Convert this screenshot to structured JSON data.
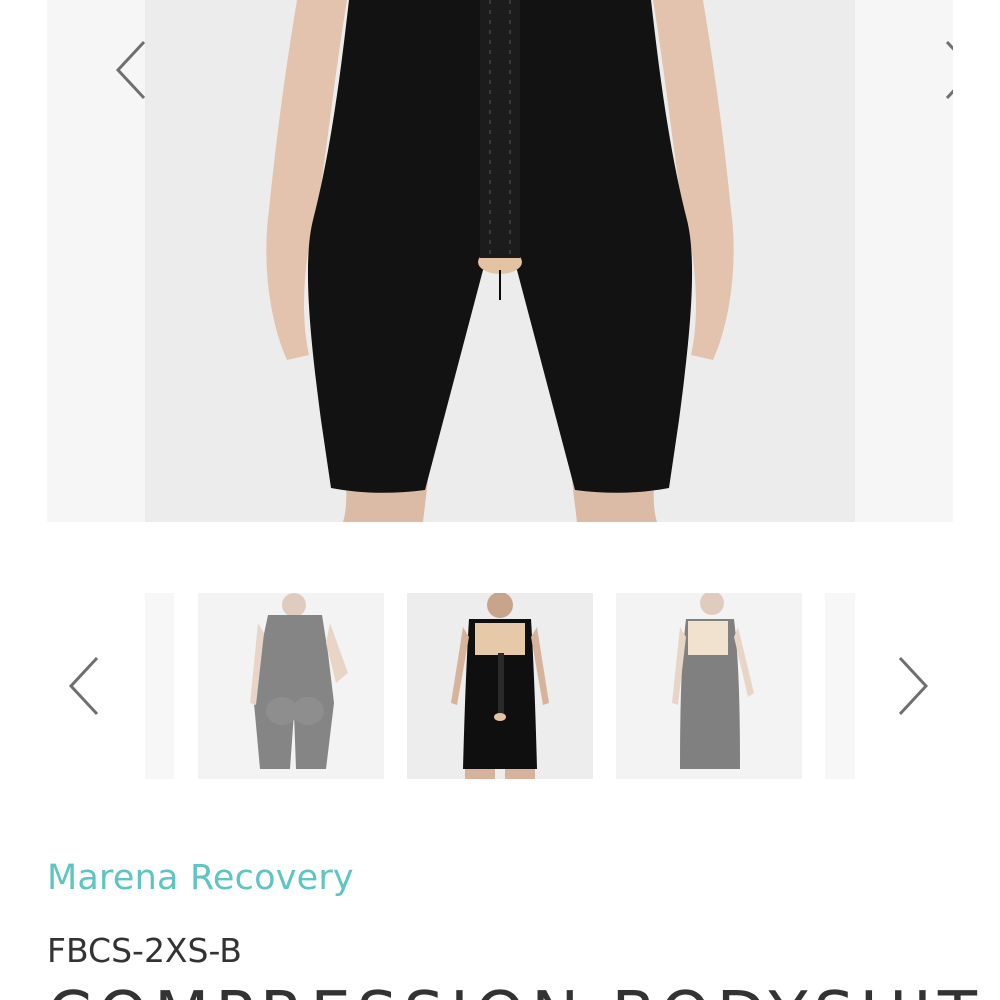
{
  "gallery": {
    "main_image_alt": "Black full-body compression bodysuit with front hook closure",
    "prev_label": "Previous image",
    "next_label": "Next image",
    "thumbnails": [
      {
        "name": "side-edge",
        "state": "dim"
      },
      {
        "name": "back-view",
        "state": "dim"
      },
      {
        "name": "front-view",
        "state": "selected"
      },
      {
        "name": "angle-view",
        "state": "dim"
      },
      {
        "name": "next-edge",
        "state": "dim"
      }
    ],
    "icons": {
      "prev": "chevron-left-icon",
      "next": "chevron-right-icon"
    },
    "colors": {
      "arrow": "#6f6f6f",
      "garment": "#111111",
      "bra_nude": "#e6c9a8"
    }
  },
  "product": {
    "brand": "Marena Recovery",
    "sku": "FBCS-2XS-B",
    "title": "COMPRESSION BODYSUIT"
  },
  "colors": {
    "brand_accent": "#5ec5c2",
    "text": "#333333"
  }
}
